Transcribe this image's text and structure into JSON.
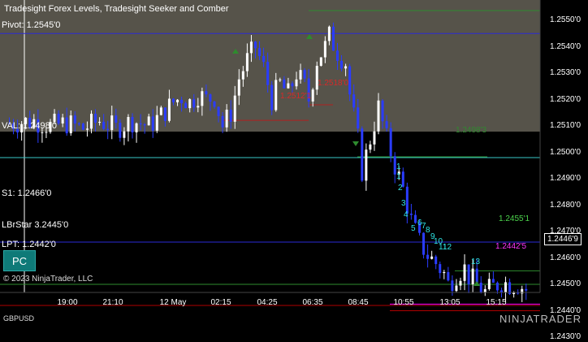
{
  "window": {
    "title": "Tradesight Forex Levels, Tradesight Seeker and Comber",
    "symbol": "GBPUSD"
  },
  "levels": {
    "pivot": "Pivot: 1.2545'0",
    "val": "VAL: 1.2498'0",
    "s1": "S1: 1.2466'0",
    "overlap": "LBrStar 3.2445'0",
    "lpt": "LPT: 1.2442'0"
  },
  "annotations": {
    "red_mid": "1.2512'1",
    "red_high": "1.2518'0",
    "green_val": "1.2498'3",
    "green_right": "1.2455'1",
    "magenta_right": "1.2442'5"
  },
  "seq_numbers": [
    "1",
    "1",
    "2",
    "3",
    "4",
    "5",
    "6",
    "7",
    "8",
    "9",
    "10",
    "11",
    "12",
    "13"
  ],
  "pc_button": "PC",
  "current_price": "1.2446'9",
  "copyright": "© 2023 NinjaTrader, LLC",
  "logo": "NINJATRADER",
  "y_axis_ticks": [
    "1.2550'0",
    "1.2540'0",
    "1.2530'0",
    "1.2520'0",
    "1.2510'0",
    "1.2500'0",
    "1.2490'0",
    "1.2480'0",
    "1.2470'0",
    "1.2460'0",
    "1.2450'0",
    "1.2440'0",
    "1.2430'0"
  ],
  "x_axis_ticks": [
    "19:00",
    "21:10",
    "12 May",
    "02:15",
    "04:25",
    "06:35",
    "08:45",
    "10:55",
    "13:05",
    "15:15"
  ],
  "colors": {
    "value_area": "#56534a",
    "pivot": "#2a2ad6",
    "val": "#39c8c8",
    "lpt": "#b00000",
    "magenta": "#ff00ff",
    "bull": "#ffffff",
    "bear": "#2a3cff"
  },
  "chart_data": {
    "type": "candlestick",
    "title": "Tradesight Forex Levels, Tradesight Seeker and Comber",
    "ylim": [
      1.2425,
      1.2558
    ],
    "close_path": [
      [
        0,
        1.2511
      ],
      [
        6,
        1.2512
      ],
      [
        10,
        1.251
      ],
      [
        14,
        1.2511
      ],
      [
        18,
        1.2509
      ],
      [
        22,
        1.2512
      ],
      [
        26,
        1.2509
      ],
      [
        30,
        1.2512
      ],
      [
        34,
        1.251
      ],
      [
        37,
        1.2514
      ],
      [
        40,
        1.2519
      ],
      [
        42,
        1.2521
      ],
      [
        44,
        1.2519
      ],
      [
        46,
        1.2522
      ],
      [
        48,
        1.252
      ],
      [
        50,
        1.2521
      ],
      [
        52,
        1.251
      ],
      [
        54,
        1.2515
      ],
      [
        56,
        1.2528
      ],
      [
        58,
        1.2535
      ],
      [
        60,
        1.254
      ],
      [
        62,
        1.2532
      ],
      [
        64,
        1.252
      ],
      [
        66,
        1.2526
      ],
      [
        68,
        1.2522
      ],
      [
        70,
        1.253
      ],
      [
        72,
        1.2525
      ],
      [
        73,
        1.252
      ],
      [
        75,
        1.2535
      ],
      [
        77,
        1.254
      ],
      [
        78,
        1.2544
      ],
      [
        80,
        1.2538
      ],
      [
        82,
        1.2534
      ],
      [
        83,
        1.2522
      ],
      [
        85,
        1.2505
      ],
      [
        86,
        1.2493
      ],
      [
        88,
        1.2505
      ],
      [
        90,
        1.2517
      ],
      [
        92,
        1.2505
      ],
      [
        94,
        1.2495
      ],
      [
        96,
        1.2486
      ],
      [
        98,
        1.2474
      ],
      [
        100,
        1.2466
      ],
      [
        102,
        1.2461
      ],
      [
        104,
        1.2458
      ],
      [
        106,
        1.2454
      ],
      [
        107,
        1.245
      ],
      [
        109,
        1.2454
      ],
      [
        111,
        1.2456
      ],
      [
        112,
        1.2453
      ],
      [
        114,
        1.245
      ],
      [
        116,
        1.2447
      ],
      [
        118,
        1.2449
      ],
      [
        120,
        1.2451
      ],
      [
        122,
        1.245
      ],
      [
        124,
        1.245
      ],
      [
        126,
        1.2448
      ]
    ]
  }
}
